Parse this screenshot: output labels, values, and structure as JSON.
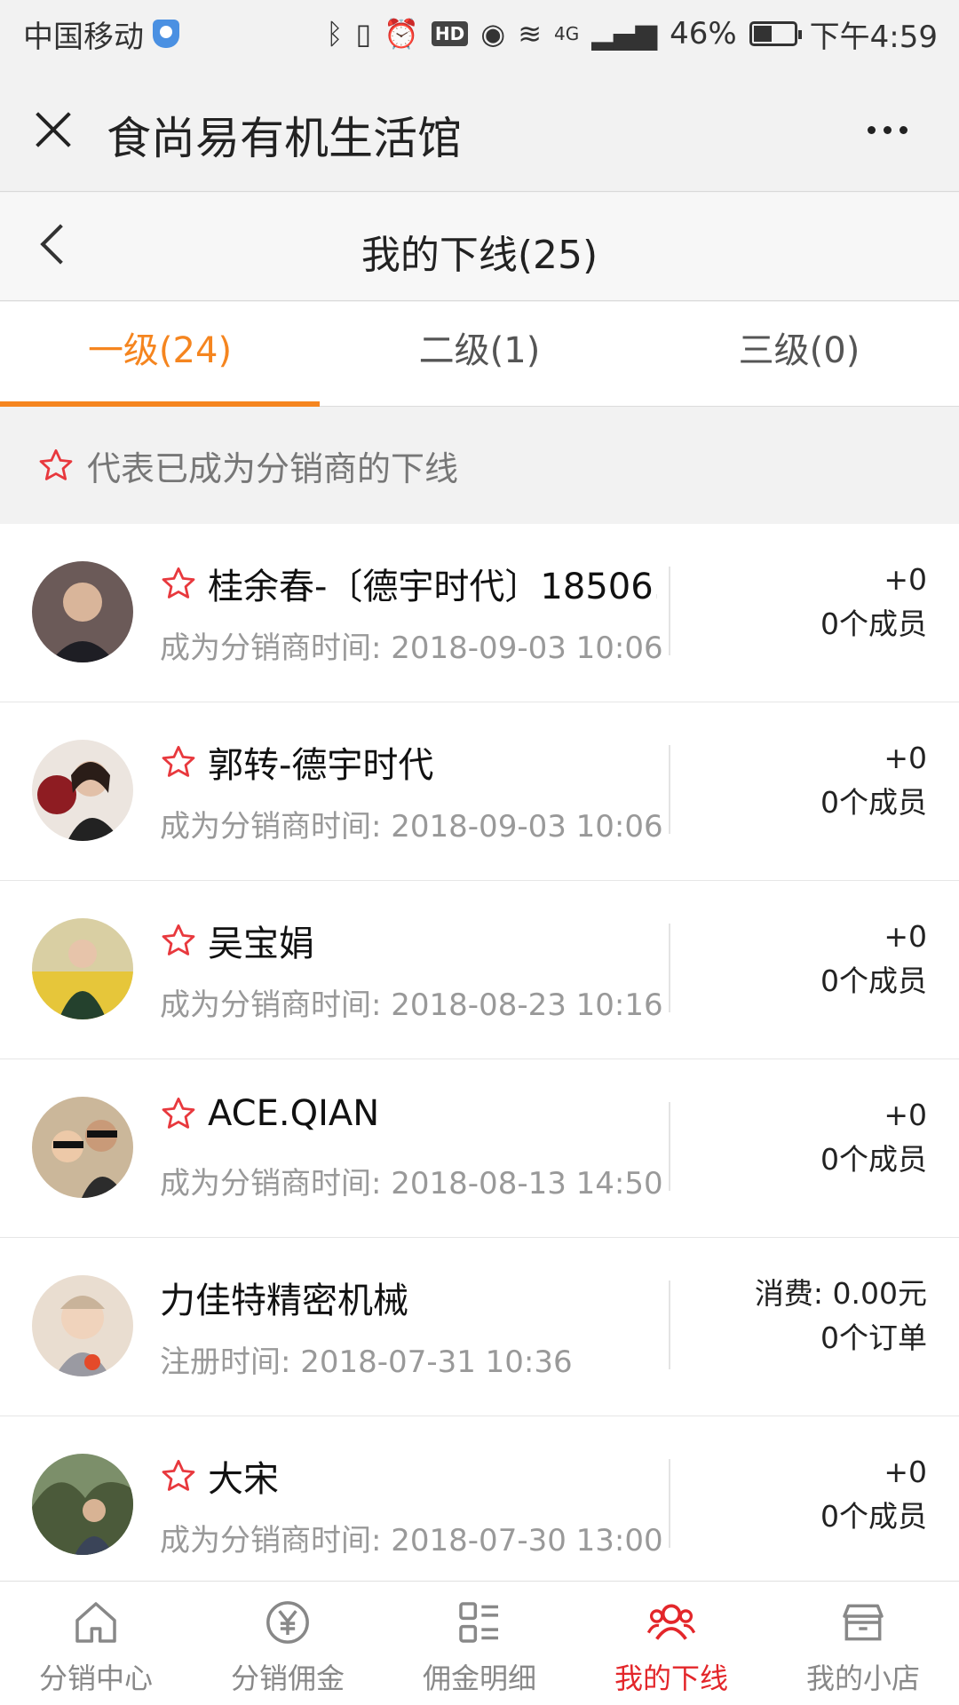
{
  "status_bar": {
    "carrier": "中国移动",
    "network": "4G",
    "battery": "46%",
    "time": "下午4:59"
  },
  "wechat_header": {
    "title": "食尚易有机生活馆"
  },
  "page_header": {
    "title": "我的下线(25)"
  },
  "tabs": [
    {
      "label": "一级(24)",
      "active": true
    },
    {
      "label": "二级(1)",
      "active": false
    },
    {
      "label": "三级(0)",
      "active": false
    }
  ],
  "notice": {
    "text": "代表已成为分销商的下线"
  },
  "members": [
    {
      "name": "桂余春-〔德宇时代〕18506...",
      "starred": true,
      "sub_label": "成为分销商时间: 2018-09-03 10:06",
      "right_top": "+0",
      "right_bottom": "0个成员",
      "avatar_color": "#3a2a26"
    },
    {
      "name": "郭转-德宇时代",
      "starred": true,
      "sub_label": "成为分销商时间: 2018-09-03 10:06",
      "right_top": "+0",
      "right_bottom": "0个成员",
      "avatar_color": "#5a2a2a"
    },
    {
      "name": "吴宝娟",
      "starred": true,
      "sub_label": "成为分销商时间: 2018-08-23 10:16",
      "right_top": "+0",
      "right_bottom": "0个成员",
      "avatar_color": "#c9a94b"
    },
    {
      "name": "ACE.QIAN",
      "starred": true,
      "sub_label": "成为分销商时间: 2018-08-13 14:50",
      "right_top": "+0",
      "right_bottom": "0个成员",
      "avatar_color": "#8a6a48"
    },
    {
      "name": "力佳特精密机械",
      "starred": false,
      "sub_label": "注册时间: 2018-07-31 10:36",
      "right_top": "消费: 0.00元",
      "right_bottom": "0个订单",
      "avatar_color": "#d7c3b0"
    },
    {
      "name": "大宋",
      "starred": true,
      "sub_label": "成为分销商时间: 2018-07-30 13:00",
      "right_top": "+0",
      "right_bottom": "0个成员",
      "avatar_color": "#5e6b4a"
    }
  ],
  "bottom_nav": [
    {
      "label": "分销中心",
      "icon": "home-icon",
      "active": false
    },
    {
      "label": "分销佣金",
      "icon": "yen-icon",
      "active": false
    },
    {
      "label": "佣金明细",
      "icon": "list-detail-icon",
      "active": false
    },
    {
      "label": "我的下线",
      "icon": "team-icon",
      "active": true
    },
    {
      "label": "我的小店",
      "icon": "shop-icon",
      "active": false
    }
  ],
  "colors": {
    "accent": "#f5851f",
    "nav_active": "#e3262a",
    "star": "#e8383d"
  }
}
